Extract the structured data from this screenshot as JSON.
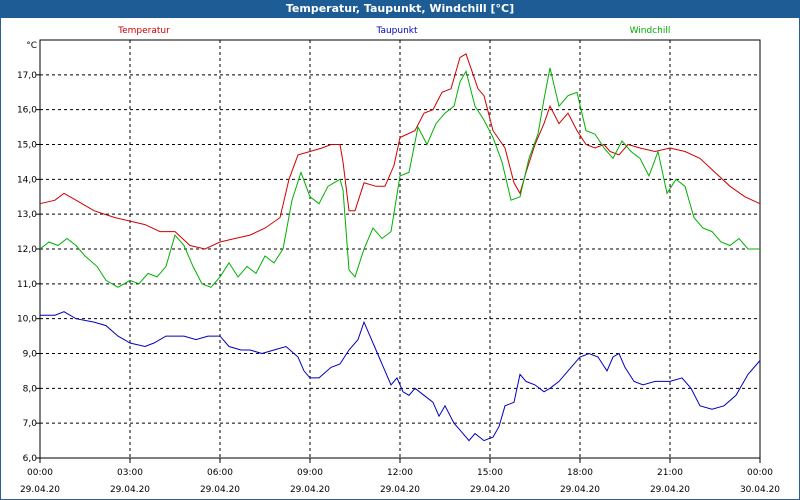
{
  "window": {
    "title": "Temperatur, Taupunkt, Windchill [°C]"
  },
  "chart_data": {
    "type": "line",
    "title": "Temperatur, Taupunkt, Windchill [°C]",
    "ylabel": "°C",
    "ylim": [
      6.0,
      18.0
    ],
    "yticks": [
      "6,0",
      "7,0",
      "8,0",
      "9,0",
      "10,0",
      "11,0",
      "12,0",
      "13,0",
      "14,0",
      "15,0",
      "16,0",
      "17,0"
    ],
    "xlim_hours": [
      0,
      24
    ],
    "xticks": [
      {
        "time": "00:00",
        "date": "29.04.20"
      },
      {
        "time": "03:00",
        "date": "29.04.20"
      },
      {
        "time": "06:00",
        "date": "29.04.20"
      },
      {
        "time": "09:00",
        "date": "29.04.20"
      },
      {
        "time": "12:00",
        "date": "29.04.20"
      },
      {
        "time": "15:00",
        "date": "29.04.20"
      },
      {
        "time": "18:00",
        "date": "29.04.20"
      },
      {
        "time": "21:00",
        "date": "29.04.20"
      },
      {
        "time": "00:00",
        "date": "30.04.20"
      }
    ],
    "grid": true,
    "series": [
      {
        "name": "Temperatur",
        "color": "#d00000",
        "points": [
          [
            0,
            13.3
          ],
          [
            0.5,
            13.4
          ],
          [
            0.8,
            13.6
          ],
          [
            1.2,
            13.4
          ],
          [
            1.8,
            13.1
          ],
          [
            2.5,
            12.9
          ],
          [
            3.0,
            12.8
          ],
          [
            3.5,
            12.7
          ],
          [
            4.0,
            12.5
          ],
          [
            4.5,
            12.5
          ],
          [
            5.0,
            12.1
          ],
          [
            5.5,
            12.0
          ],
          [
            6.0,
            12.2
          ],
          [
            6.5,
            12.3
          ],
          [
            7.0,
            12.4
          ],
          [
            7.5,
            12.6
          ],
          [
            8.0,
            12.9
          ],
          [
            8.3,
            14.0
          ],
          [
            8.6,
            14.7
          ],
          [
            9.0,
            14.8
          ],
          [
            9.4,
            14.9
          ],
          [
            9.7,
            15.0
          ],
          [
            10.0,
            15.0
          ],
          [
            10.1,
            14.5
          ],
          [
            10.3,
            13.1
          ],
          [
            10.5,
            13.1
          ],
          [
            10.8,
            13.9
          ],
          [
            11.2,
            13.8
          ],
          [
            11.5,
            13.8
          ],
          [
            11.8,
            14.4
          ],
          [
            12.0,
            15.2
          ],
          [
            12.5,
            15.4
          ],
          [
            12.8,
            15.9
          ],
          [
            13.1,
            16.0
          ],
          [
            13.4,
            16.5
          ],
          [
            13.7,
            16.6
          ],
          [
            13.9,
            17.2
          ],
          [
            14.0,
            17.5
          ],
          [
            14.2,
            17.6
          ],
          [
            14.4,
            17.1
          ],
          [
            14.6,
            16.6
          ],
          [
            14.8,
            16.4
          ],
          [
            15.1,
            15.4
          ],
          [
            15.5,
            14.9
          ],
          [
            15.8,
            13.9
          ],
          [
            16.0,
            13.6
          ],
          [
            16.2,
            14.2
          ],
          [
            16.5,
            15.0
          ],
          [
            16.8,
            15.6
          ],
          [
            17.0,
            16.1
          ],
          [
            17.3,
            15.6
          ],
          [
            17.6,
            15.9
          ],
          [
            17.9,
            15.4
          ],
          [
            18.2,
            15.0
          ],
          [
            18.5,
            14.9
          ],
          [
            18.8,
            15.0
          ],
          [
            19.0,
            14.8
          ],
          [
            19.3,
            14.7
          ],
          [
            19.6,
            15.0
          ],
          [
            20.0,
            14.9
          ],
          [
            20.5,
            14.8
          ],
          [
            21.0,
            14.9
          ],
          [
            21.5,
            14.8
          ],
          [
            22.0,
            14.6
          ],
          [
            22.5,
            14.2
          ],
          [
            23.0,
            13.8
          ],
          [
            23.5,
            13.5
          ],
          [
            24.0,
            13.3
          ]
        ]
      },
      {
        "name": "Taupunkt",
        "color": "#0000c0",
        "points": [
          [
            0,
            10.1
          ],
          [
            0.5,
            10.1
          ],
          [
            0.8,
            10.2
          ],
          [
            1.2,
            10.0
          ],
          [
            1.8,
            9.9
          ],
          [
            2.2,
            9.8
          ],
          [
            2.6,
            9.5
          ],
          [
            3.0,
            9.3
          ],
          [
            3.5,
            9.2
          ],
          [
            3.8,
            9.3
          ],
          [
            4.2,
            9.5
          ],
          [
            4.8,
            9.5
          ],
          [
            5.2,
            9.4
          ],
          [
            5.6,
            9.5
          ],
          [
            6.0,
            9.5
          ],
          [
            6.3,
            9.2
          ],
          [
            6.7,
            9.1
          ],
          [
            7.0,
            9.1
          ],
          [
            7.4,
            9.0
          ],
          [
            7.8,
            9.1
          ],
          [
            8.2,
            9.2
          ],
          [
            8.6,
            8.9
          ],
          [
            8.8,
            8.5
          ],
          [
            9.0,
            8.3
          ],
          [
            9.3,
            8.3
          ],
          [
            9.7,
            8.6
          ],
          [
            10.0,
            8.7
          ],
          [
            10.3,
            9.1
          ],
          [
            10.6,
            9.4
          ],
          [
            10.8,
            9.9
          ],
          [
            11.0,
            9.5
          ],
          [
            11.2,
            9.1
          ],
          [
            11.5,
            8.5
          ],
          [
            11.7,
            8.1
          ],
          [
            11.9,
            8.3
          ],
          [
            12.1,
            7.9
          ],
          [
            12.3,
            7.8
          ],
          [
            12.5,
            8.0
          ],
          [
            12.8,
            7.8
          ],
          [
            13.1,
            7.6
          ],
          [
            13.3,
            7.2
          ],
          [
            13.5,
            7.5
          ],
          [
            13.8,
            7.0
          ],
          [
            14.0,
            6.8
          ],
          [
            14.3,
            6.5
          ],
          [
            14.5,
            6.7
          ],
          [
            14.8,
            6.5
          ],
          [
            15.1,
            6.6
          ],
          [
            15.3,
            6.9
          ],
          [
            15.5,
            7.5
          ],
          [
            15.8,
            7.6
          ],
          [
            16.0,
            8.4
          ],
          [
            16.2,
            8.2
          ],
          [
            16.5,
            8.1
          ],
          [
            16.8,
            7.9
          ],
          [
            17.0,
            8.0
          ],
          [
            17.3,
            8.2
          ],
          [
            17.6,
            8.5
          ],
          [
            18.0,
            8.9
          ],
          [
            18.3,
            9.0
          ],
          [
            18.6,
            8.9
          ],
          [
            18.9,
            8.5
          ],
          [
            19.1,
            8.9
          ],
          [
            19.3,
            9.0
          ],
          [
            19.5,
            8.6
          ],
          [
            19.8,
            8.2
          ],
          [
            20.1,
            8.1
          ],
          [
            20.5,
            8.2
          ],
          [
            21.0,
            8.2
          ],
          [
            21.4,
            8.3
          ],
          [
            21.7,
            8.0
          ],
          [
            22.0,
            7.5
          ],
          [
            22.4,
            7.4
          ],
          [
            22.8,
            7.5
          ],
          [
            23.2,
            7.8
          ],
          [
            23.6,
            8.4
          ],
          [
            24.0,
            8.8
          ]
        ]
      },
      {
        "name": "Windchill",
        "color": "#00b000",
        "points": [
          [
            0,
            12.0
          ],
          [
            0.3,
            12.2
          ],
          [
            0.6,
            12.1
          ],
          [
            0.9,
            12.3
          ],
          [
            1.2,
            12.1
          ],
          [
            1.5,
            11.8
          ],
          [
            1.9,
            11.5
          ],
          [
            2.2,
            11.1
          ],
          [
            2.6,
            10.9
          ],
          [
            3.0,
            11.1
          ],
          [
            3.3,
            11.0
          ],
          [
            3.6,
            11.3
          ],
          [
            3.9,
            11.2
          ],
          [
            4.2,
            11.5
          ],
          [
            4.5,
            12.4
          ],
          [
            4.8,
            12.1
          ],
          [
            5.1,
            11.5
          ],
          [
            5.4,
            11.0
          ],
          [
            5.7,
            10.9
          ],
          [
            6.0,
            11.2
          ],
          [
            6.3,
            11.6
          ],
          [
            6.6,
            11.2
          ],
          [
            6.9,
            11.5
          ],
          [
            7.2,
            11.3
          ],
          [
            7.5,
            11.8
          ],
          [
            7.8,
            11.6
          ],
          [
            8.1,
            12.0
          ],
          [
            8.4,
            13.4
          ],
          [
            8.7,
            14.2
          ],
          [
            9.0,
            13.5
          ],
          [
            9.3,
            13.3
          ],
          [
            9.6,
            13.8
          ],
          [
            10.0,
            14.0
          ],
          [
            10.1,
            13.7
          ],
          [
            10.3,
            11.4
          ],
          [
            10.5,
            11.2
          ],
          [
            10.8,
            12.0
          ],
          [
            11.1,
            12.6
          ],
          [
            11.4,
            12.3
          ],
          [
            11.7,
            12.5
          ],
          [
            12.0,
            14.1
          ],
          [
            12.3,
            14.2
          ],
          [
            12.6,
            15.5
          ],
          [
            12.9,
            15.0
          ],
          [
            13.2,
            15.6
          ],
          [
            13.5,
            15.9
          ],
          [
            13.8,
            16.1
          ],
          [
            14.0,
            16.8
          ],
          [
            14.2,
            17.1
          ],
          [
            14.5,
            16.1
          ],
          [
            14.8,
            15.7
          ],
          [
            15.1,
            15.2
          ],
          [
            15.4,
            14.5
          ],
          [
            15.7,
            13.4
          ],
          [
            16.0,
            13.5
          ],
          [
            16.3,
            14.6
          ],
          [
            16.6,
            15.3
          ],
          [
            16.8,
            16.3
          ],
          [
            17.0,
            17.2
          ],
          [
            17.3,
            16.1
          ],
          [
            17.6,
            16.4
          ],
          [
            17.9,
            16.5
          ],
          [
            18.2,
            15.4
          ],
          [
            18.5,
            15.3
          ],
          [
            18.8,
            14.9
          ],
          [
            19.1,
            14.6
          ],
          [
            19.4,
            15.1
          ],
          [
            19.7,
            14.8
          ],
          [
            20.0,
            14.6
          ],
          [
            20.3,
            14.1
          ],
          [
            20.6,
            14.8
          ],
          [
            20.9,
            13.6
          ],
          [
            21.2,
            14.0
          ],
          [
            21.5,
            13.8
          ],
          [
            21.8,
            12.9
          ],
          [
            22.1,
            12.6
          ],
          [
            22.4,
            12.5
          ],
          [
            22.7,
            12.2
          ],
          [
            23.0,
            12.1
          ],
          [
            23.3,
            12.3
          ],
          [
            23.6,
            12.0
          ],
          [
            24.0,
            12.0
          ]
        ]
      }
    ]
  }
}
